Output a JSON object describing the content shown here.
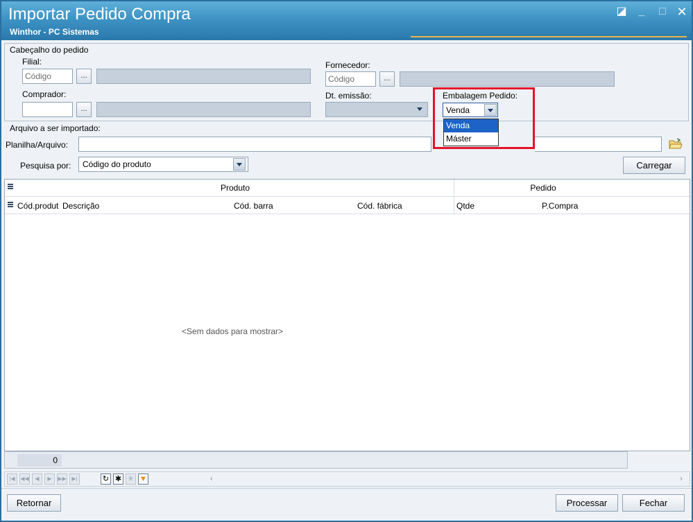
{
  "window": {
    "title": "Importar Pedido Compra",
    "subtitle": "Winthor - PC Sistemas",
    "controls": {
      "restore": "◪",
      "minimize": "_",
      "maximize": "□",
      "close": "✕"
    }
  },
  "header": {
    "section_label": "Cabeçalho do pedido",
    "filial_label": "Filial:",
    "filial_placeholder": "Código",
    "fornecedor_label": "Fornecedor:",
    "fornecedor_placeholder": "Código",
    "comprador_label": "Comprador:",
    "comprador_value": "",
    "dt_emissao_label": "Dt. emissão:",
    "dt_emissao_value": "",
    "dots": "...",
    "embalagem_label": "Embalagem Pedido:",
    "embalagem_value": "Venda",
    "embalagem_options": [
      "Venda",
      "Máster"
    ]
  },
  "arquivo": {
    "section_label": "Arquivo a ser importado:",
    "planilha_label": "Planilha/Arquivo:",
    "planilha_value": "",
    "pesquisa_label": "Pesquisa por:",
    "pesquisa_value": "Código do produto",
    "carregar_label": "Carregar"
  },
  "grid": {
    "bands": [
      "Produto",
      "Pedido"
    ],
    "columns": [
      "Cód.produto",
      "Descrição",
      "Cód. barra",
      "Cód. fábrica",
      "Qtde",
      "P.Compra"
    ],
    "empty_text": "<Sem dados para mostrar>",
    "footer_count": "0"
  },
  "navigator": {
    "buttons": [
      "first",
      "prev-page",
      "prev",
      "next",
      "next-page",
      "last",
      "refresh",
      "insert",
      "delete",
      "filter"
    ]
  },
  "footer": {
    "retornar_label": "Retornar",
    "processar_label": "Processar",
    "fechar_label": "Fechar"
  },
  "colors": {
    "title_gradient_top": "#5fb0d9",
    "title_gradient_bottom": "#2a78ab",
    "highlight_border": "#e4132b",
    "selected_option": "#1d63c7"
  }
}
